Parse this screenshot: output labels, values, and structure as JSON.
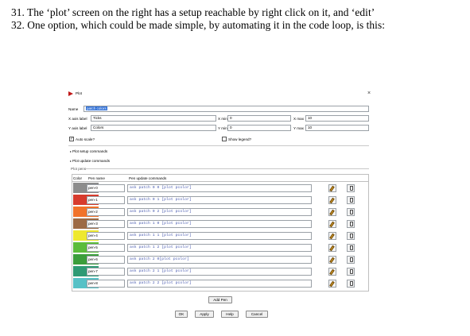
{
  "document": {
    "line31": "31. The ‘plot’ screen on the right has a setup reachable by right click on it, and ‘edit’",
    "line32": "32. One option, which could be made simple, by automating it in the code loop, is this:"
  },
  "dialog": {
    "title": "Plot",
    "close_glyph": "×",
    "name_label": "Name",
    "name_value": "patch colors",
    "x_axis_label_label": "X axis label",
    "x_axis_label_value": "Ticks",
    "y_axis_label_label": "Y axis label",
    "y_axis_label_value": "Colors",
    "x_min_label": "X min",
    "x_min_value": "0",
    "x_max_label": "X max",
    "x_max_value": "10",
    "y_min_label": "Y min",
    "y_min_value": "0",
    "y_max_label": "Y max",
    "y_max_value": "10",
    "auto_scale_label": "Auto scale?",
    "auto_scale_checked": true,
    "show_legend_label": "Show legend?",
    "show_legend_checked": false,
    "plot_setup_label": "Plot setup commands",
    "plot_update_label": "Plot update commands",
    "plot_pens_label": "Plot pens",
    "table_headers": {
      "color": "Color",
      "pen_name": "Pen name",
      "pen_update": "Pen update commands"
    },
    "pens": [
      {
        "color": "#8c8c8c",
        "name": "pen-0",
        "code": "ask patch 0 0 [plot pcolor]"
      },
      {
        "color": "#d73b2d",
        "name": "pen-1",
        "code": "ask patch 0 1 [plot pcolor]"
      },
      {
        "color": "#f1722a",
        "name": "pen-2",
        "code": "ask patch 0 2 [plot pcolor]"
      },
      {
        "color": "#9c6a45",
        "name": "pen-3",
        "code": "ask patch 1 0 [plot pcolor]"
      },
      {
        "color": "#eee82f",
        "name": "pen-4",
        "code": "ask patch 1 1 [plot pcolor]"
      },
      {
        "color": "#5cbc3b",
        "name": "pen-5",
        "code": "ask patch 1 2 [plot pcolor]"
      },
      {
        "color": "#3b9e3b",
        "name": "pen-6",
        "code": "ask patch 2 0[plot pcolor]"
      },
      {
        "color": "#2e9a74",
        "name": "pen-7",
        "code": "ask patch 2 1 [plot pcolor]"
      },
      {
        "color": "#56c1c6",
        "name": "pen-8",
        "code": "ask patch 2 2 [plot pcolor]"
      }
    ],
    "add_pen_label": "Add Pen",
    "buttons": {
      "ok": "OK",
      "apply": "Apply",
      "help": "Help",
      "cancel": "Cancel"
    }
  }
}
